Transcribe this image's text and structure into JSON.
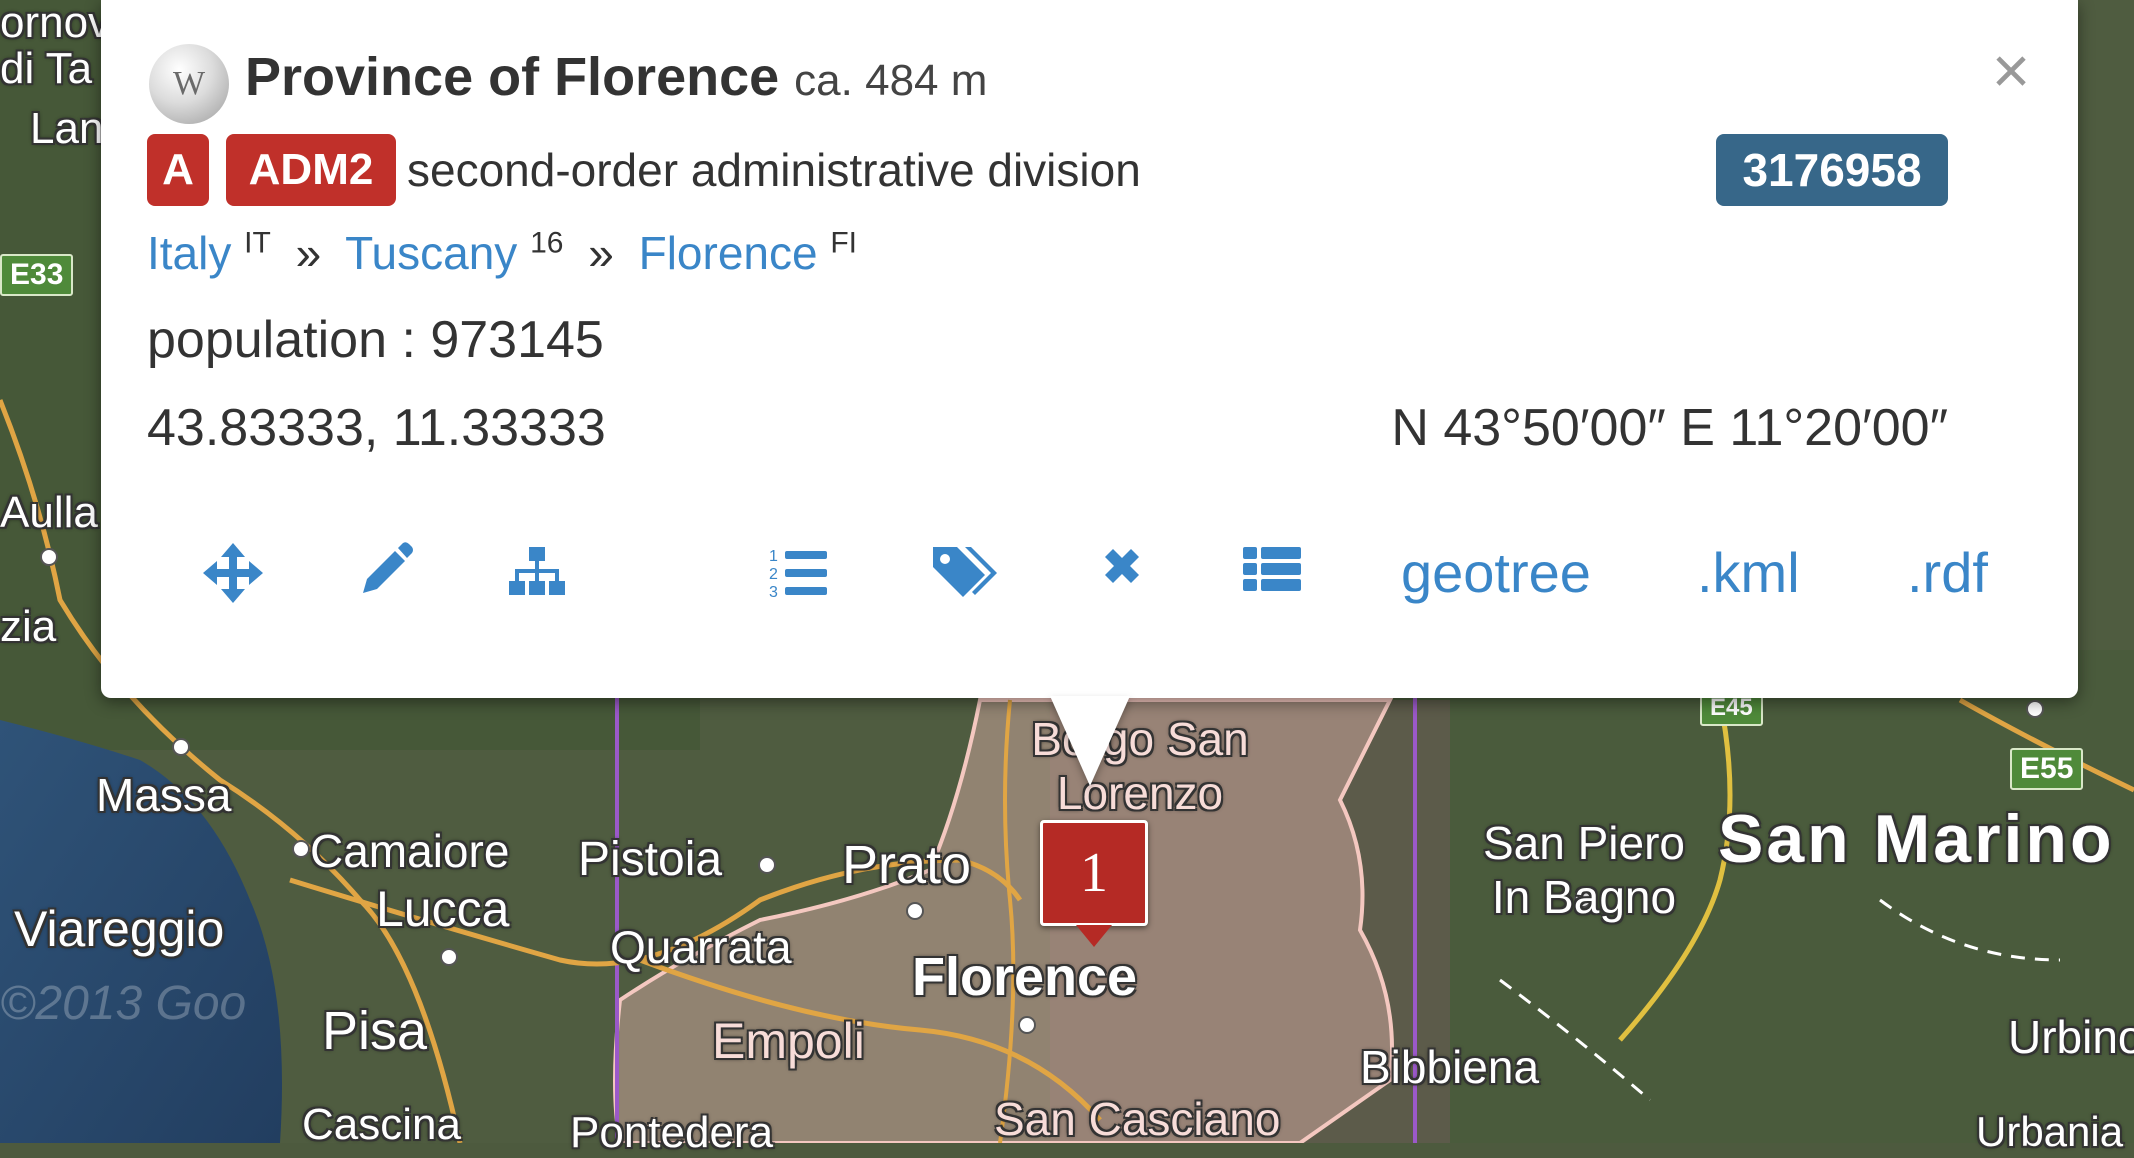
{
  "map": {
    "labels": [
      {
        "id": "map-label-massa",
        "text": "Massa"
      },
      {
        "id": "map-label-camaiore",
        "text": "Camaiore"
      },
      {
        "id": "map-label-pistoia",
        "text": "Pistoia"
      },
      {
        "id": "map-label-prato",
        "text": "Prato"
      },
      {
        "id": "map-label-lucca",
        "text": "Lucca"
      },
      {
        "id": "map-label-viareggio",
        "text": "Viareggio"
      },
      {
        "id": "map-label-quarrata",
        "text": "Quarrata"
      },
      {
        "id": "map-label-florence",
        "text": "Florence"
      },
      {
        "id": "map-label-empoli",
        "text": "Empoli"
      },
      {
        "id": "map-label-pisa",
        "text": "Pisa"
      },
      {
        "id": "map-label-cascina",
        "text": "Cascina"
      },
      {
        "id": "map-label-pontedera",
        "text": "Pontedera"
      },
      {
        "id": "map-label-san-casciano",
        "text": "San Casciano"
      },
      {
        "id": "map-label-borgo-san-lorenzo",
        "text": "Borgo San Lorenzo"
      },
      {
        "id": "map-label-san-piero",
        "text": "San Piero In Bagno"
      },
      {
        "id": "map-label-san-marino",
        "text": "San Marino"
      },
      {
        "id": "map-label-bibbiena",
        "text": "Bibbiena"
      },
      {
        "id": "map-label-urbino",
        "text": "Urbino"
      },
      {
        "id": "map-label-urbania",
        "text": "Urbania"
      },
      {
        "id": "map-label-aulla",
        "text": "Aulla"
      },
      {
        "id": "map-label-zia",
        "text": "zia"
      },
      {
        "id": "map-label-lan",
        "text": "Lan"
      },
      {
        "id": "map-label-di-ta",
        "text": "di Ta"
      },
      {
        "id": "map-label-fornov",
        "text": "ornov"
      }
    ],
    "shields": [
      {
        "id": "road-shield-e33",
        "text": "E33"
      },
      {
        "id": "road-shield-e55",
        "text": "E55"
      },
      {
        "id": "road-shield-e45",
        "text": "E45"
      }
    ],
    "marker_label": "1",
    "watermark": "©2013 Goo"
  },
  "popup": {
    "wiki_icon_label": "W",
    "name": "Province of Florence",
    "elevation": "ca. 484 m",
    "close_symbol": "×",
    "feature_class": "A",
    "feature_code": "ADM2",
    "feature_description": "second-order administrative division",
    "geoname_id": "3176958",
    "breadcrumb": [
      {
        "label": "Italy",
        "code": "IT"
      },
      {
        "label": "Tuscany",
        "code": "16"
      },
      {
        "label": "Florence",
        "code": "FI"
      }
    ],
    "breadcrumb_separator": "»",
    "population": "population : 973145",
    "decimal_coordinates": "43.83333, 11.33333",
    "dms_coordinates": "N 43°50′00″ E 11°20′00″",
    "toolbar": {
      "icons": [
        "move-icon",
        "edit-icon",
        "hierarchy-icon",
        "ordered-list-icon",
        "tag-icon",
        "close-icon",
        "list-icon"
      ],
      "geotree_label": "geotree",
      "kml_label": ".kml",
      "rdf_label": ".rdf"
    }
  },
  "colors": {
    "link": "#3a86c8",
    "badge_red": "#c0302a",
    "id_badge": "#376789",
    "marker": "#b52a25",
    "province_overlay": "#e3b4ac"
  }
}
